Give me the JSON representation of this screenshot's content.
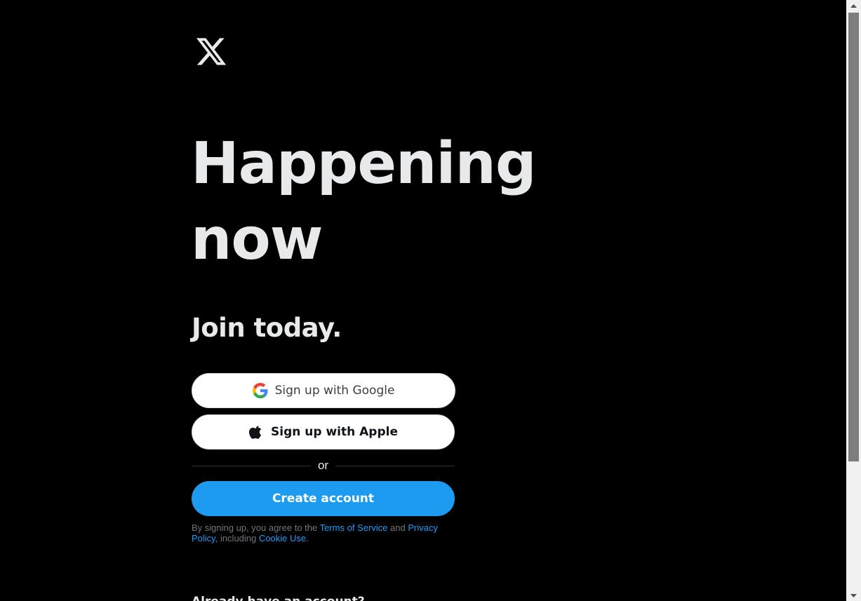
{
  "logo": {
    "icon": "x-logo-icon"
  },
  "hero": {
    "headline_line1": "Happening",
    "headline_line2": "now",
    "subheadline": "Join today."
  },
  "signup": {
    "google_label": "Sign up with Google",
    "google_icon": "google-icon",
    "apple_label": "Sign up with Apple",
    "apple_icon": "apple-icon",
    "divider_text": "or",
    "create_account_label": "Create account"
  },
  "legal": {
    "prefix": "By signing up, you agree to the ",
    "terms_link": "Terms of Service",
    "and": " and ",
    "privacy_link": "Privacy Policy",
    "including": ", including ",
    "cookie_link": "Cookie Use",
    "suffix": "."
  },
  "signin": {
    "prompt": "Already have an account?"
  },
  "colors": {
    "background": "#000000",
    "accent": "#1d9bf0",
    "text": "#e7e9ea",
    "muted": "#71767b"
  }
}
